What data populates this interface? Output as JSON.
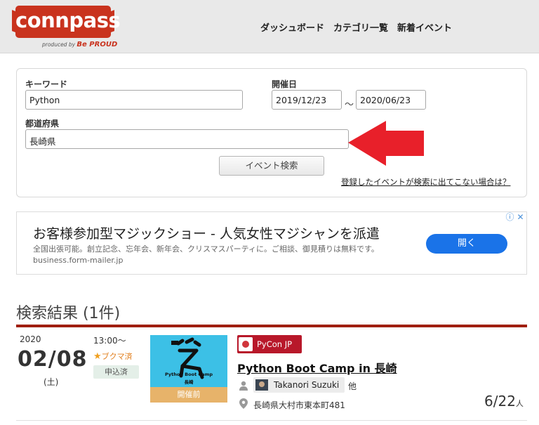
{
  "header": {
    "logo_text": "connpass",
    "logo_sub_prefix": "produced by",
    "logo_sub_brand": "Be PROUD",
    "nav": [
      "ダッシュボード",
      "カテゴリ一覧",
      "新着イベント"
    ],
    "colors": {
      "brand": "#c9331e",
      "background": "#e9e9e9"
    }
  },
  "search": {
    "keyword_label": "キーワード",
    "keyword_value": "Python",
    "date_label": "開催日",
    "date_from": "2019/12/23",
    "date_separator": "〜",
    "date_to": "2020/06/23",
    "prefecture_label": "都道府県",
    "prefecture_value": "長崎県",
    "search_button": "イベント検索",
    "help_link": "登録したイベントが検索に出てこない場合は？"
  },
  "annotation": {
    "arrow_icon": "red-arrow-left-icon",
    "color": "#e8202a"
  },
  "ad": {
    "title": "お客様参加型マジックショー - 人気女性マジシャンを派遣",
    "description": "全国出張可能。創立記念、忘年会、新年会、クリスマスパーティに。ご相談、御見積りは無料です。 business.form-mailer.jp",
    "button": "開く",
    "icons": [
      "info-icon",
      "close-icon"
    ]
  },
  "results": {
    "heading": "検索結果 (1件)",
    "events": [
      {
        "year": "2020",
        "date": "02/08",
        "weekday": "(土)",
        "time": "13:00〜",
        "bookmark": "ブクマ済",
        "status_badge": "申込済",
        "thumbnail_caption_1": "Python Boot Camp",
        "thumbnail_caption_2": "長崎",
        "thumbnail_status": "開催前",
        "group_name": "PyCon JP",
        "title": "Python Boot Camp in 長崎",
        "owner": "Takanori Suzuki",
        "owner_suffix": "他",
        "address": "長崎県大村市東本町481",
        "participants": "6/22",
        "participants_unit": "人"
      }
    ]
  }
}
